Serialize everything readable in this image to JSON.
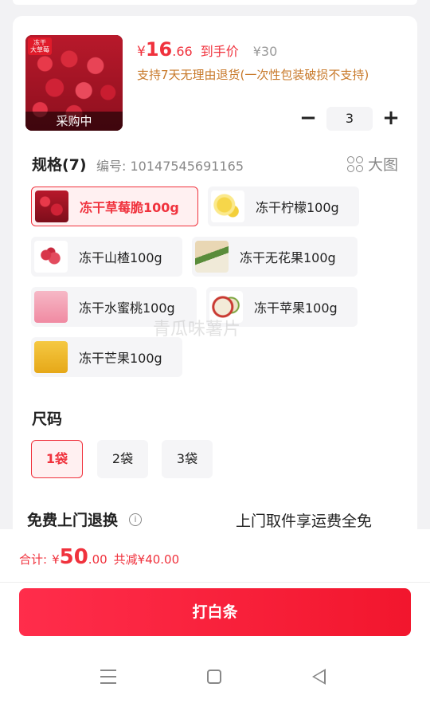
{
  "product": {
    "thumb_tag": "冻干\n大草莓",
    "thumb_caption": "采购中",
    "price_currency": "¥",
    "price_int": "16",
    "price_dec": ".66",
    "price_label": "到手价",
    "original_price": "¥30",
    "return_note": "支持7天无理由退货(一次性包装破损不支持)",
    "quantity": "3",
    "minus": "−",
    "plus": "+"
  },
  "spec": {
    "title": "规格(7)",
    "code": "编号: 10147545691165",
    "big_image_label": "大图",
    "options": [
      {
        "label": "冻干草莓脆100g",
        "icon": "strawberry",
        "selected": true
      },
      {
        "label": "冻干柠檬100g",
        "icon": "lemon",
        "selected": false
      },
      {
        "label": "冻干山楂100g",
        "icon": "hawthorn",
        "selected": false
      },
      {
        "label": "冻干无花果100g",
        "icon": "fig",
        "selected": false
      },
      {
        "label": "冻干水蜜桃100g",
        "icon": "peach",
        "selected": false
      },
      {
        "label": "冻干苹果100g",
        "icon": "apple",
        "selected": false
      },
      {
        "label": "冻干芒果100g",
        "icon": "mango",
        "selected": false
      }
    ]
  },
  "watermark": "青瓜味薯片",
  "size": {
    "title": "尺码",
    "options": [
      {
        "label": "1袋",
        "selected": true
      },
      {
        "label": "2袋",
        "selected": false
      },
      {
        "label": "3袋",
        "selected": false
      }
    ]
  },
  "free_return": {
    "title": "免费上门退换",
    "info_glyph": "i",
    "desc": "上门取件享运费全免"
  },
  "footer": {
    "total_label": "合计:",
    "total_currency": "¥",
    "total_int": "50",
    "total_dec": ".00",
    "saved": "共减¥40.00",
    "pay_button": "打白条"
  },
  "colors": {
    "accent": "#f0323d",
    "note": "#c8792a"
  }
}
